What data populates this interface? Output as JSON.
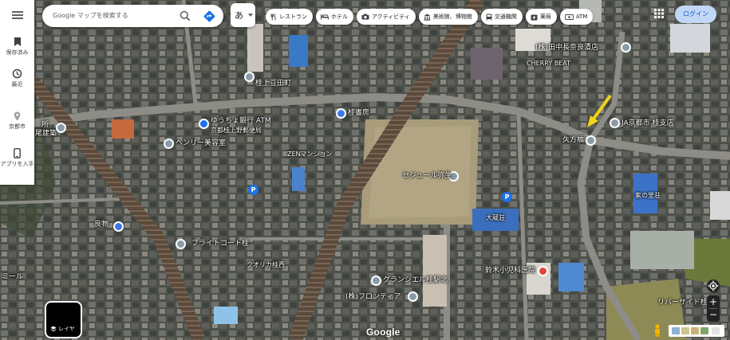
{
  "sidebar": {
    "items": [
      {
        "label": "",
        "icon": "hamburger-icon"
      },
      {
        "label": "保存済み",
        "icon": "bookmark-icon"
      },
      {
        "label": "最近",
        "icon": "history-icon"
      },
      {
        "label": "京都市",
        "icon": "place-icon"
      },
      {
        "label": "アプリを入手",
        "icon": "phone-icon"
      }
    ]
  },
  "search": {
    "placeholder": "Google マップを検索する"
  },
  "language": {
    "glyph": "あ"
  },
  "chips": [
    {
      "label": "レストラン",
      "icon": "restaurant-icon"
    },
    {
      "label": "ホテル",
      "icon": "hotel-icon"
    },
    {
      "label": "アクティビティ",
      "icon": "camera-icon"
    },
    {
      "label": "美術館、博物館",
      "icon": "museum-icon"
    },
    {
      "label": "交通機関",
      "icon": "transit-icon"
    },
    {
      "label": "薬局",
      "icon": "pharmacy-icon"
    },
    {
      "label": "ATM",
      "icon": "atm-icon"
    }
  ],
  "header": {
    "login_label": "ログイン"
  },
  "layer_button": {
    "label": "レイヤ"
  },
  "map": {
    "attribution": "Google",
    "labels": [
      {
        "text": "ゆうちょ銀行 ATM",
        "kind": "atm"
      },
      {
        "text": "京都桂上野郵便局",
        "kind": "plain"
      },
      {
        "text": "桂上豆田町",
        "kind": "plain"
      },
      {
        "text": "ヘンリー美容室",
        "kind": "pin"
      },
      {
        "text": "桂書房",
        "kind": "blue"
      },
      {
        "text": "セジュール弥生",
        "kind": "pin"
      },
      {
        "text": "ブライトコート桂",
        "kind": "pin"
      },
      {
        "text": "クオリカ桂西",
        "kind": "plain"
      },
      {
        "text": "グランシエル桂駅北",
        "kind": "pin"
      },
      {
        "text": "(株)フロンティア",
        "kind": "pin"
      },
      {
        "text": "(株)田中長奈良漬店",
        "kind": "pin"
      },
      {
        "text": "JA京都市 桂支店",
        "kind": "pin"
      },
      {
        "text": "久方橋",
        "kind": "pin"
      },
      {
        "text": "CHERRY BEAT",
        "kind": "plain"
      },
      {
        "text": "鈴木小児科医院",
        "kind": "red"
      },
      {
        "text": "リバーサイド桂",
        "kind": "plain"
      },
      {
        "text": "大蔵荘",
        "kind": "plain"
      },
      {
        "text": "紫の里荘",
        "kind": "plain"
      },
      {
        "text": "ZENマンション",
        "kind": "plain"
      },
      {
        "text": "所",
        "kind": "plain"
      },
      {
        "text": "尾建築",
        "kind": "plain"
      },
      {
        "text": "ミール",
        "kind": "plain"
      },
      {
        "text": "良物",
        "kind": "blue"
      }
    ]
  },
  "colors": {
    "accent": "#1a73e8",
    "login_bg": "#c2d7f5",
    "login_text": "#0b57d0",
    "marker": "#f2d21b"
  }
}
